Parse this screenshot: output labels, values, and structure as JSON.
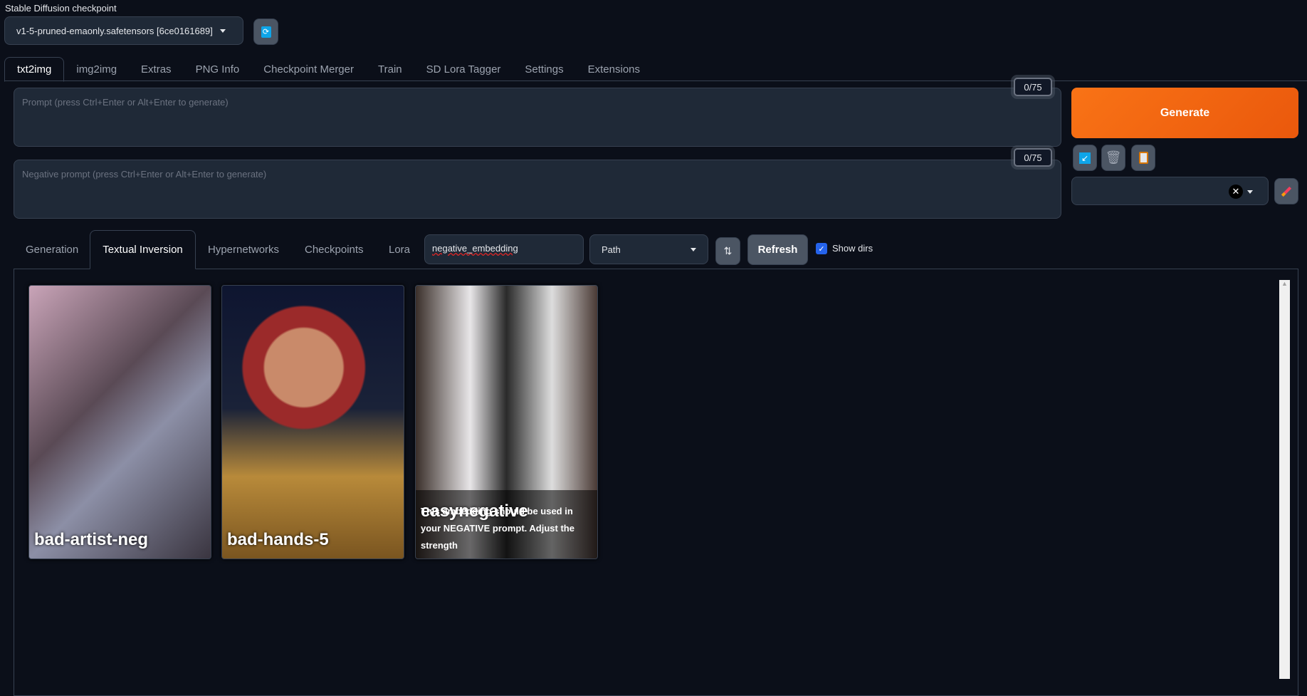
{
  "checkpoint": {
    "label": "Stable Diffusion checkpoint",
    "value": "v1-5-pruned-emaonly.safetensors [6ce0161689]",
    "refresh_icon": "refresh-icon"
  },
  "tabs": [
    "txt2img",
    "img2img",
    "Extras",
    "PNG Info",
    "Checkpoint Merger",
    "Train",
    "SD Lora Tagger",
    "Settings",
    "Extensions"
  ],
  "prompt": {
    "placeholder": "Prompt (press Ctrl+Enter or Alt+Enter to generate)",
    "count": "0/75"
  },
  "negative": {
    "placeholder": "Negative prompt (press Ctrl+Enter or Alt+Enter to generate)",
    "count": "0/75"
  },
  "generate": "Generate",
  "accent": "#f97316",
  "subtabs": [
    "Generation",
    "Textual Inversion",
    "Hypernetworks",
    "Checkpoints",
    "Lora"
  ],
  "search": {
    "value": "negative_embedding"
  },
  "sort": {
    "value": "Path"
  },
  "refresh": "Refresh",
  "show_dirs": {
    "label": "Show dirs",
    "checked": true
  },
  "cards": [
    {
      "name": "bad-artist-neg",
      "desc": ""
    },
    {
      "name": "bad-hands-5",
      "desc": ""
    },
    {
      "name": "easynegative",
      "desc": "This embedding should be used in your NEGATIVE prompt. Adjust the strength"
    }
  ]
}
